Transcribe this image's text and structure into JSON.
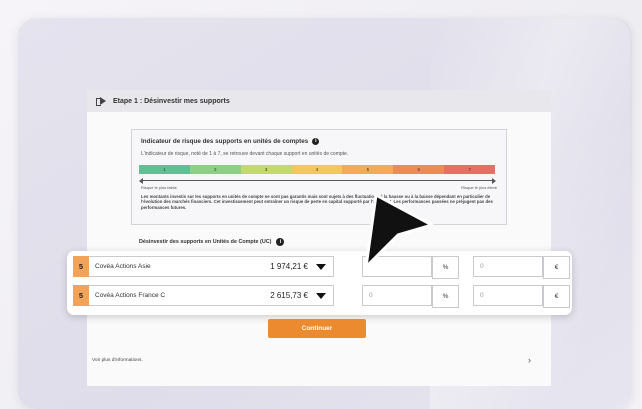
{
  "step": {
    "title": "Etape 1 : Désinvestir mes supports"
  },
  "risk": {
    "title": "Indicateur de risque des supports en unités de comptes",
    "subtitle": "L'indicateur de risque, noté de 1 à 7, se retrouve devant chaque support en unités de compte.",
    "levels": [
      "1",
      "2",
      "3",
      "4",
      "5",
      "6",
      "7"
    ],
    "level_colors": [
      "#5ec196",
      "#8dcf84",
      "#c3d96a",
      "#f0c95a",
      "#f3ab55",
      "#ee8a5a",
      "#e96e66"
    ],
    "low_label": "Risque le plus faible",
    "high_label": "Risque le plus élevé",
    "disclaimer": "Les montants investis sur les supports en unités de compte ne sont pas garantis mais sont sujets à des fluctuations à la hausse ou à la baisse dépendant en particulier de l'évolution des marchés financiers. Cet investissement peut entraîner un risque de perte en capital supporté par l'adhérent. Les performances passées ne préjugent pas des performances futures."
  },
  "divest": {
    "title": "Désinvestir des supports en Unités de Compte (UC)",
    "rows": [
      {
        "risk": "5",
        "name": "Covéa Actions Asie",
        "amount": "1 974,21 €",
        "percent": "",
        "percent_unit": "%",
        "euro": "0",
        "euro_unit": "€"
      },
      {
        "risk": "5",
        "name": "Covéa Actions France C",
        "amount": "2 615,73 €",
        "percent": "0",
        "percent_unit": "%",
        "euro": "0",
        "euro_unit": "€"
      }
    ]
  },
  "actions": {
    "continue_label": "Continuer",
    "more_info_label": "Voir plus d'informations.",
    "chevron": "›"
  },
  "colors": {
    "accent": "#eb8a2e",
    "risk_badge": "#f1a35a"
  }
}
